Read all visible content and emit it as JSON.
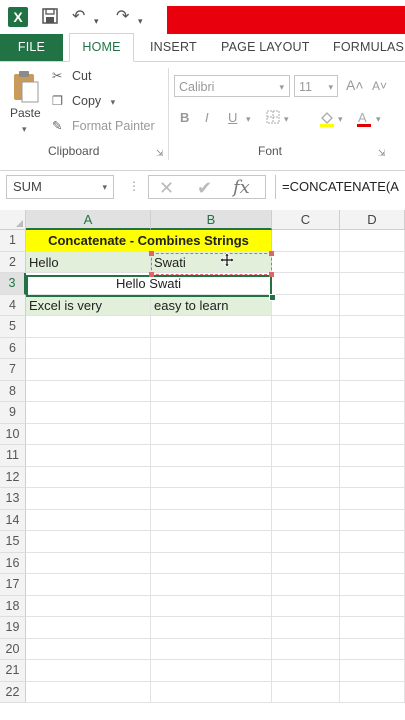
{
  "title_bar": {
    "app_icon": "X"
  },
  "tabs": [
    "FILE",
    "HOME",
    "INSERT",
    "PAGE LAYOUT",
    "FORMULAS"
  ],
  "clipboard": {
    "paste": "Paste",
    "cut": "Cut",
    "copy": "Copy",
    "format_painter": "Format Painter",
    "group_label": "Clipboard"
  },
  "font": {
    "name": "Calibri",
    "size": "11",
    "group_label": "Font",
    "bold": "B",
    "italic": "I",
    "underline": "U"
  },
  "formula_bar": {
    "name_box": "SUM",
    "formula": "=CONCATENATE(A"
  },
  "grid": {
    "columns": [
      "A",
      "B",
      "C",
      "D"
    ],
    "rows": [
      "1",
      "2",
      "3",
      "4",
      "5",
      "6",
      "7",
      "8",
      "9",
      "10",
      "11",
      "12",
      "13",
      "14",
      "15",
      "16",
      "17",
      "18",
      "19",
      "20",
      "21",
      "22"
    ],
    "cells": {
      "A1": "Concatenate - Combines Strings",
      "A2": "Hello",
      "B2": "Swati",
      "A3": "Hello Swati",
      "A4": "Excel is very",
      "B4": "easy to learn"
    }
  },
  "colors": {
    "accent": "#217346",
    "header_fill": "#ffff00",
    "row2_fill": "#e2efda",
    "reference_border": "#e06666"
  }
}
